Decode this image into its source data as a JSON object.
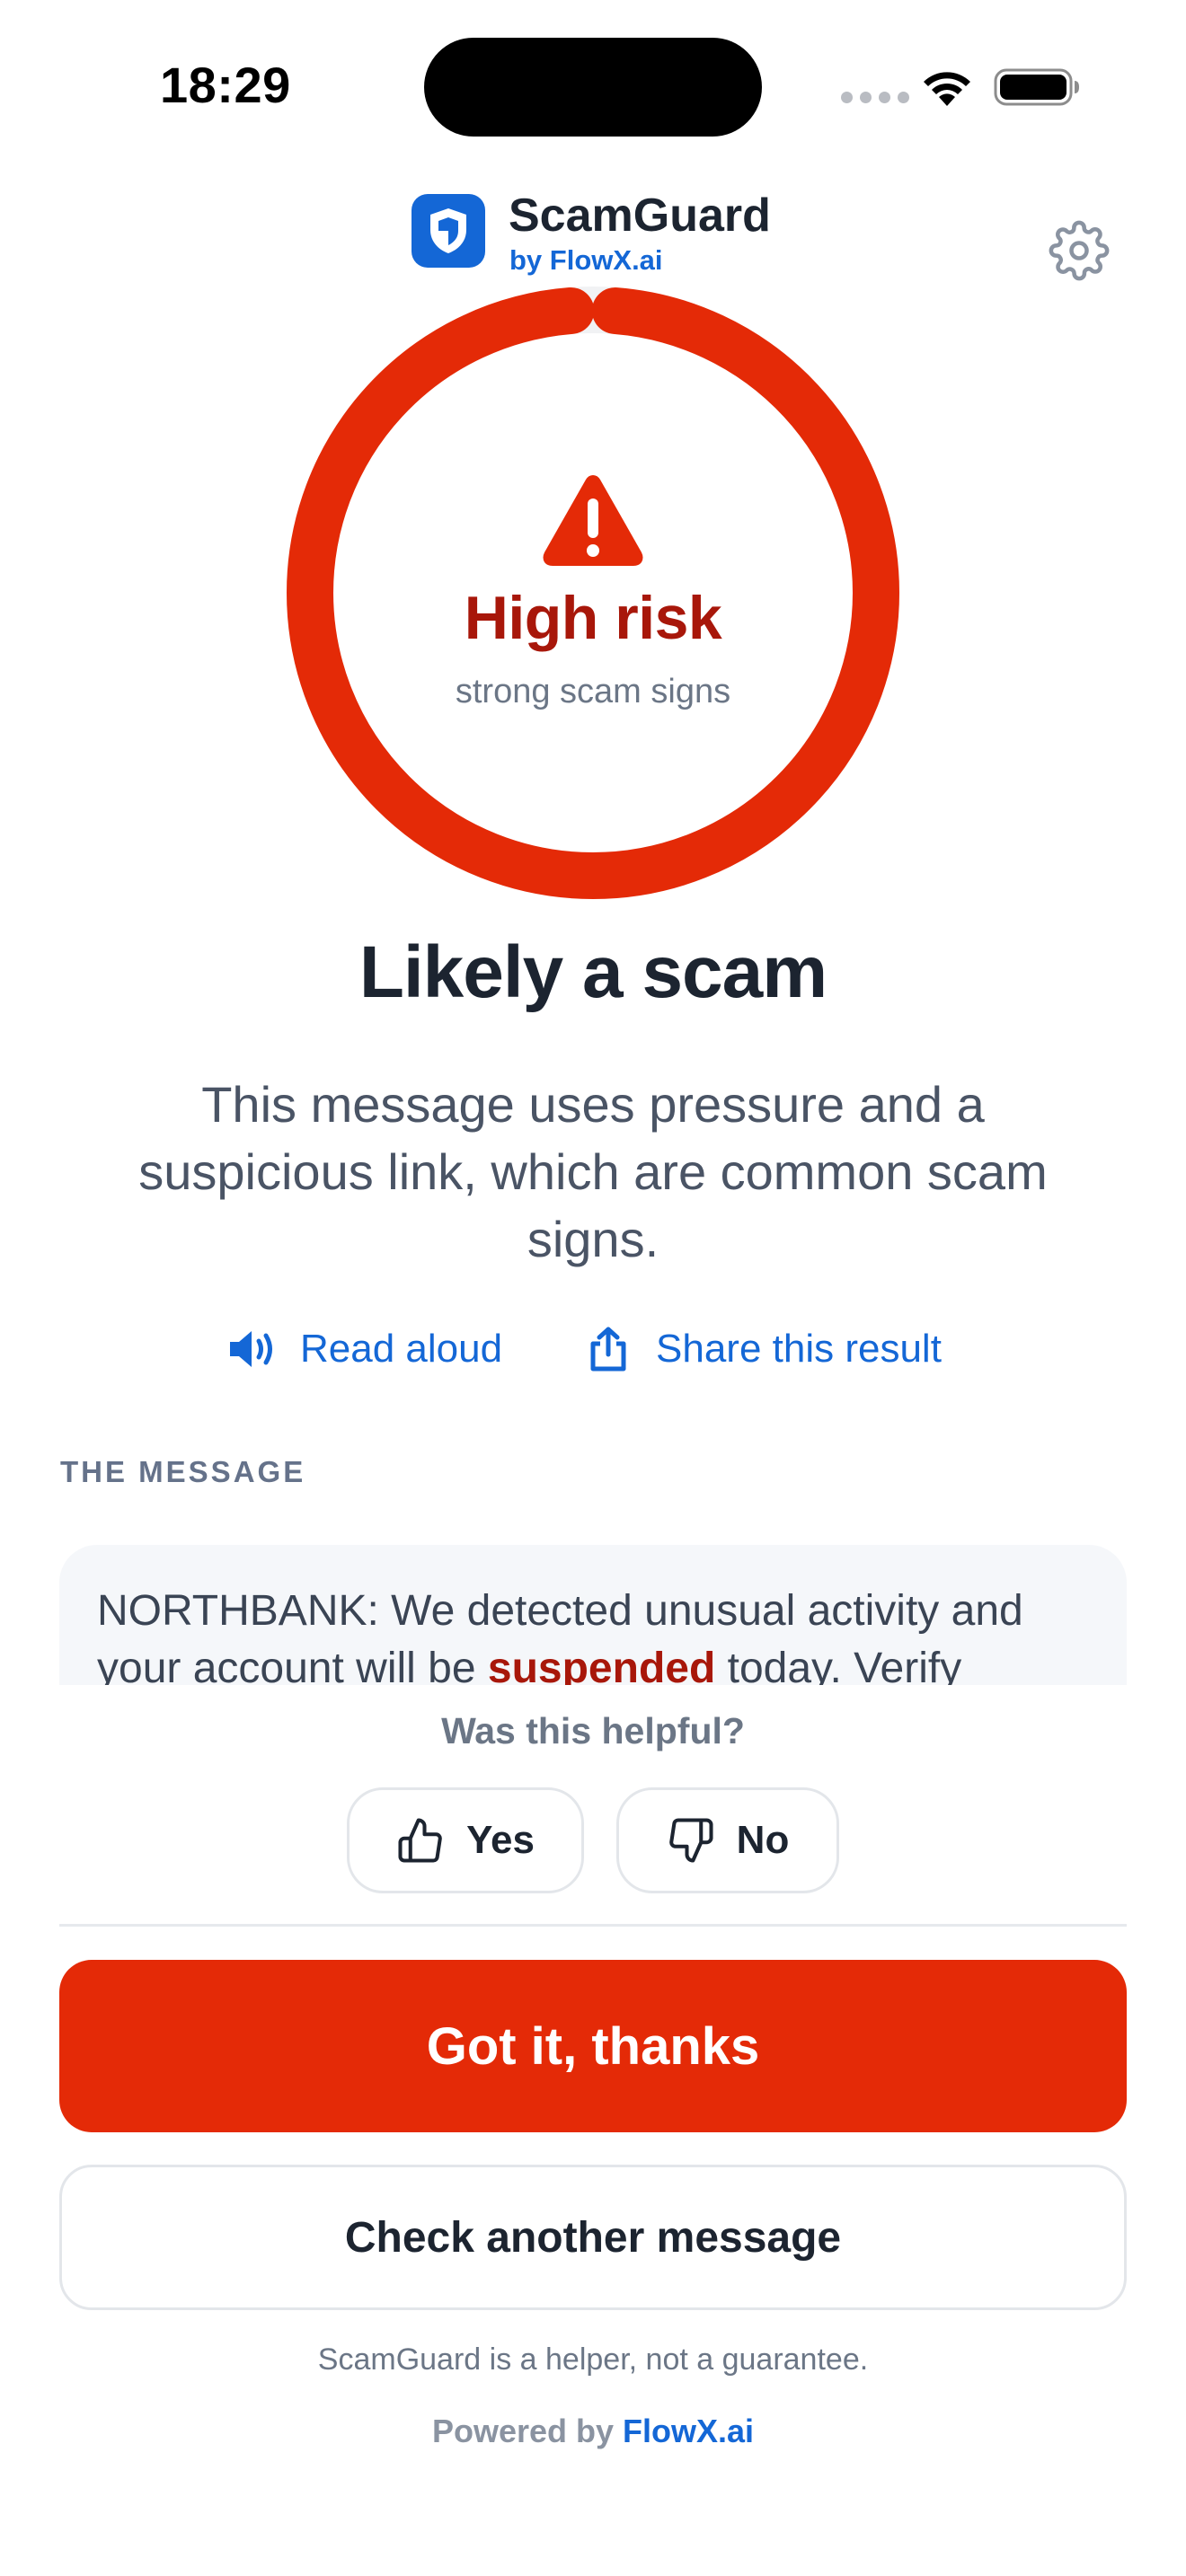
{
  "status_bar": {
    "time": "18:29",
    "icons": [
      "cellular-signal-icon",
      "wifi-icon",
      "battery-icon"
    ]
  },
  "header": {
    "app_name": "ScamGuard",
    "byline": "by FlowX.ai",
    "logo_icon": "shield-icon",
    "settings_icon": "gear-icon"
  },
  "risk": {
    "level_label": "High risk",
    "sublabel": "strong scam signs",
    "icon": "warning-triangle-icon",
    "gauge_fill": 0.99,
    "color": "#e42a07",
    "label_color": "#a8170a"
  },
  "verdict": {
    "title": "Likely a scam",
    "description": "This message uses pressure and a suspicious link, which are common scam signs."
  },
  "actions": {
    "read_aloud": "Read aloud",
    "share": "Share this result"
  },
  "message": {
    "section_label": "THE MESSAGE",
    "text_before": "NORTHBANK: We detected unusual activity and your account will be ",
    "highlight": "suspended",
    "text_after": " today. Verify"
  },
  "feedback": {
    "question": "Was this helpful?",
    "yes": "Yes",
    "no": "No"
  },
  "buttons": {
    "primary": "Got it, thanks",
    "secondary": "Check another message"
  },
  "footer": {
    "disclaimer": "ScamGuard is a helper, not a guarantee.",
    "powered_prefix": "Powered by",
    "powered_brand": "FlowX.ai"
  },
  "colors": {
    "accent": "#1467d6",
    "danger": "#e42a07"
  }
}
